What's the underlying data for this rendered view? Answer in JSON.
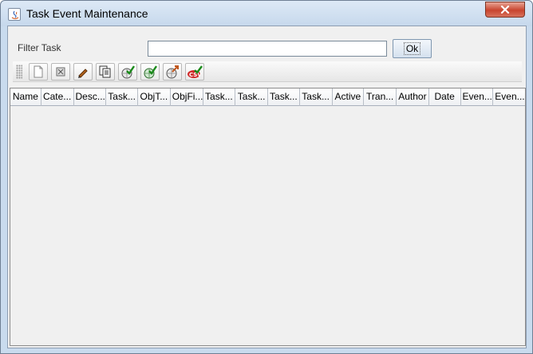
{
  "window": {
    "title": "Task Event Maintenance"
  },
  "filter": {
    "label": "Filter Task",
    "value": "",
    "ok_label": "Ok"
  },
  "toolbar": {
    "buttons": [
      {
        "name": "new-icon"
      },
      {
        "name": "delete-icon"
      },
      {
        "name": "edit-pencil-icon"
      },
      {
        "name": "copy-icon"
      },
      {
        "name": "globe-check-icon"
      },
      {
        "name": "globe-add-icon"
      },
      {
        "name": "globe-export-icon"
      },
      {
        "name": "csv-export-icon"
      }
    ]
  },
  "table": {
    "columns": [
      "Name",
      "Cate...",
      "Desc...",
      "Task...",
      "ObjT...",
      "ObjFi...",
      "Task...",
      "Task...",
      "Task...",
      "Task...",
      "Active",
      "Tran...",
      "Author",
      "Date",
      "Even...",
      "Even..."
    ],
    "rows": []
  }
}
